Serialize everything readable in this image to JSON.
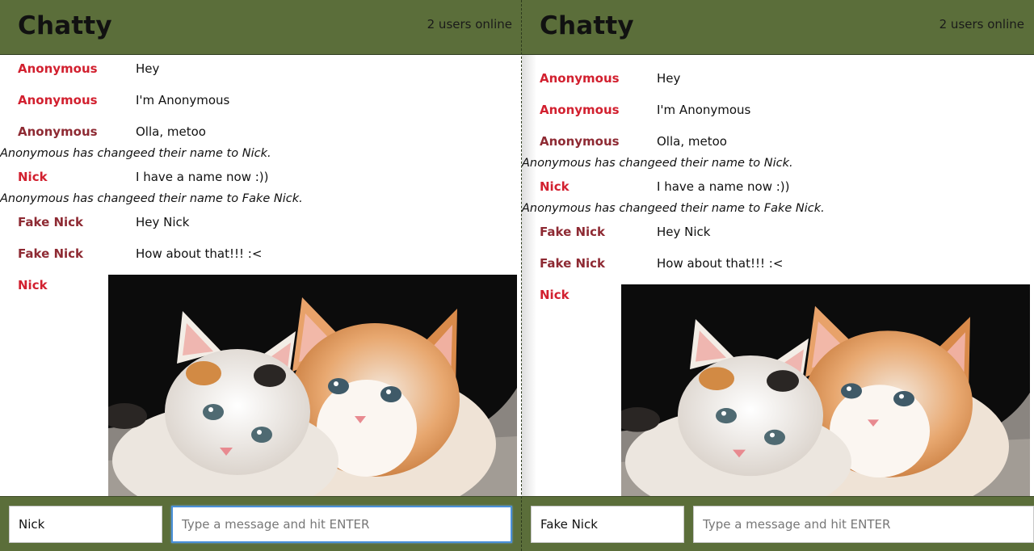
{
  "colors": {
    "header_bg": "#5b6e3a",
    "username_red": "#d2202f",
    "username_dark_red": "#8e2a33",
    "focus_blue": "#4a90d9"
  },
  "panes": [
    {
      "app_title": "Chatty",
      "users_online": "2 users online",
      "messages": [
        {
          "type": "message",
          "user": "Anonymous",
          "color": "#d2202f",
          "text": "Hey"
        },
        {
          "type": "message",
          "user": "Anonymous",
          "color": "#d2202f",
          "text": "I'm Anonymous"
        },
        {
          "type": "message",
          "user": "Anonymous",
          "color": "#8e2a33",
          "text": "Olla, metoo"
        },
        {
          "type": "notification",
          "text": "Anonymous has changeed their name to Nick."
        },
        {
          "type": "message",
          "user": "Nick",
          "color": "#d2202f",
          "text": "I have a name now :))"
        },
        {
          "type": "notification",
          "text": "Anonymous has changeed their name to Fake Nick."
        },
        {
          "type": "message",
          "user": "Fake Nick",
          "color": "#8e2a33",
          "text": "Hey Nick"
        },
        {
          "type": "message",
          "user": "Fake Nick",
          "color": "#8e2a33",
          "text": "How about that!!! :<"
        },
        {
          "type": "image",
          "user": "Nick",
          "color": "#d2202f",
          "image": "kittens-photo"
        }
      ],
      "name_value": "Nick",
      "message_placeholder": "Type a message and hit ENTER"
    },
    {
      "app_title": "Chatty",
      "users_online": "2 users online",
      "messages": [
        {
          "type": "message",
          "user": "Anonymous",
          "color": "#d2202f",
          "text": "Hey"
        },
        {
          "type": "message",
          "user": "Anonymous",
          "color": "#d2202f",
          "text": "I'm Anonymous"
        },
        {
          "type": "message",
          "user": "Anonymous",
          "color": "#8e2a33",
          "text": "Olla, metoo"
        },
        {
          "type": "notification",
          "text": "Anonymous has changeed their name to Nick."
        },
        {
          "type": "message",
          "user": "Nick",
          "color": "#d2202f",
          "text": "I have a name now :))"
        },
        {
          "type": "notification",
          "text": "Anonymous has changeed their name to Fake Nick."
        },
        {
          "type": "message",
          "user": "Fake Nick",
          "color": "#8e2a33",
          "text": "Hey Nick"
        },
        {
          "type": "message",
          "user": "Fake Nick",
          "color": "#8e2a33",
          "text": "How about that!!! :<"
        },
        {
          "type": "image",
          "user": "Nick",
          "color": "#d2202f",
          "image": "kittens-photo"
        }
      ],
      "name_value": "Fake Nick",
      "message_placeholder": "Type a message and hit ENTER"
    }
  ]
}
